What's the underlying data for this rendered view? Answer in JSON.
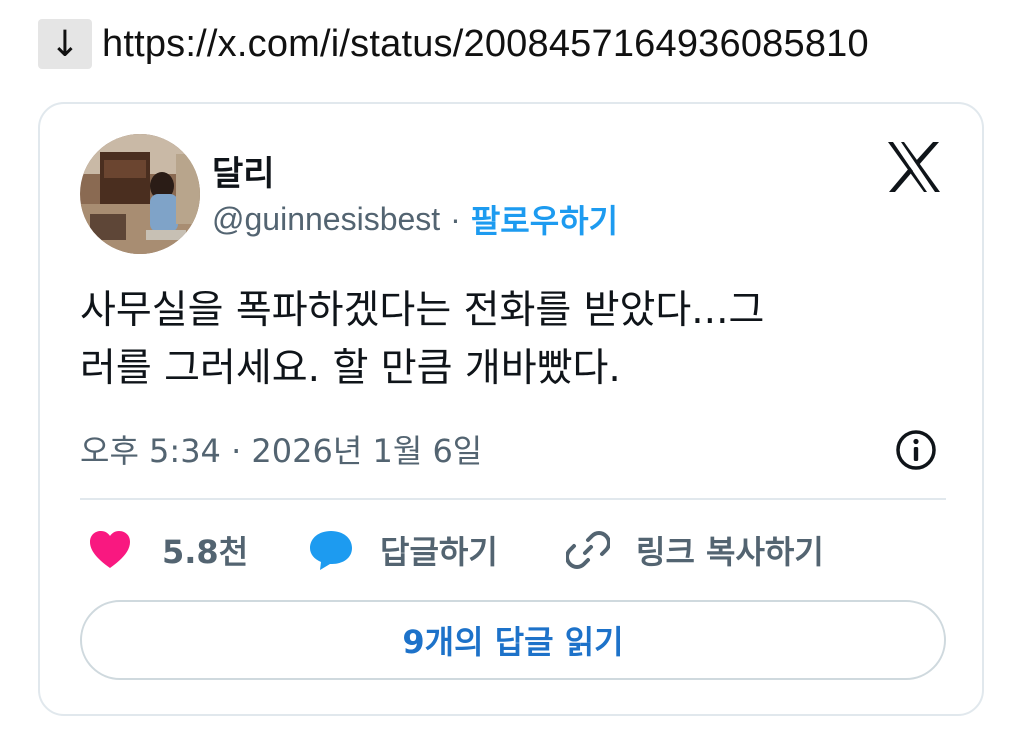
{
  "urlbar": {
    "arrow": "↓",
    "url": "https://x.com/i/status/2008457164936085810"
  },
  "tweet": {
    "display_name": "달리",
    "handle": "@guinnesisbest",
    "separator": "·",
    "follow_label": "팔로우하기",
    "text_line1": "사무실을 폭파하겠다는 전화를 받았다...그",
    "text_line2": "러를 그러세요. 할 만큼 개바빴다.",
    "timestamp": "오후 5:34 · 2026년 1월 6일",
    "like_count": "5.8천",
    "reply_label": "답글하기",
    "copy_link_label": "링크 복사하기",
    "read_replies_label": "9개의 답글 읽기"
  },
  "colors": {
    "accent": "#1d9bf0",
    "like": "#f91880",
    "secondary_text": "#536471",
    "border": "#e1e8ed"
  },
  "icons": {
    "download": "down-arrow-icon",
    "x_logo": "x-logo-icon",
    "info": "info-icon",
    "like": "heart-icon",
    "reply": "speech-bubble-icon",
    "link": "link-icon"
  }
}
